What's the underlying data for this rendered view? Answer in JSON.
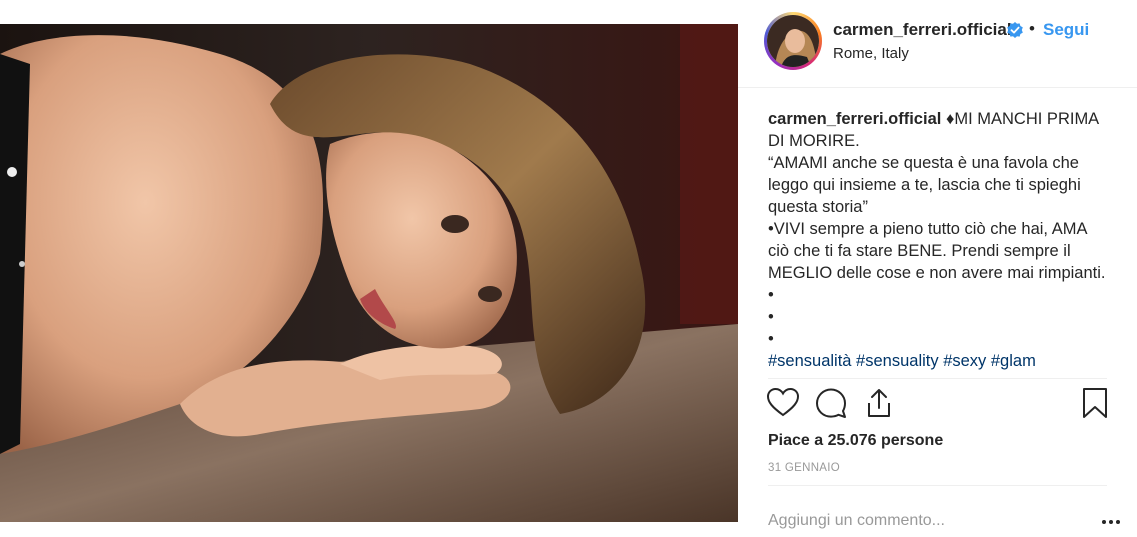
{
  "post": {
    "username": "carmen_ferreri.official",
    "follow_dot": "•",
    "follow_label": "Segui",
    "location": "Rome, Italy",
    "caption": {
      "username": "carmen_ferreri.official",
      "lines": [
        "♦MI MANCHI PRIMA DI MORIRE.",
        "“AMAMI anche se questa è una favola che leggo qui insieme a te, lascia che ti spieghi questa storia”",
        "•VIVI sempre a pieno tutto ciò che hai, AMA ciò che ti fa stare BENE. Prendi sempre il MEGLIO delle cose e non avere mai rimpianti.",
        "•",
        "•",
        "•"
      ],
      "tags_line": "#sensualità #sensuality #sexy #glam"
    },
    "likes": "Piace a 25.076 persone",
    "date": "31 GENNAIO",
    "comment_placeholder": "Aggiungi un commento..."
  },
  "icons": {
    "like": "heart-icon",
    "comment": "comment-bubble-icon",
    "share": "share-icon",
    "save": "bookmark-icon",
    "more": "more-options-icon",
    "verified": "verified-badge-icon"
  },
  "colors": {
    "link_blue": "#3897f0",
    "verified_blue": "#3897f0",
    "text": "#262626",
    "muted": "#999999"
  }
}
